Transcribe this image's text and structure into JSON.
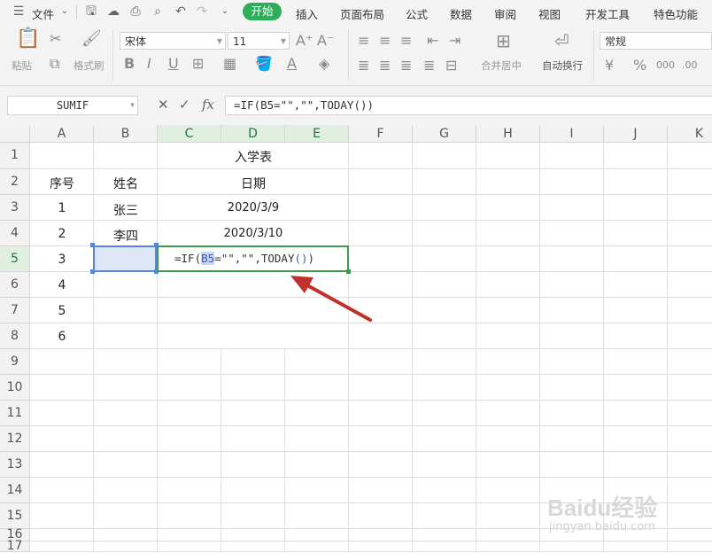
{
  "menubar": {
    "file_label": "文件",
    "tabs": [
      "开始",
      "插入",
      "页面布局",
      "公式",
      "数据",
      "审阅",
      "视图",
      "开发工具",
      "特色功能"
    ]
  },
  "ribbon": {
    "paste_label": "粘贴",
    "format_painter_label": "格式刷",
    "font_name": "宋体",
    "font_size": "11",
    "merge_center_label": "合并居中",
    "wrap_text_label": "自动换行",
    "number_format": "常规"
  },
  "formula_bar": {
    "name_box": "SUMIF",
    "formula": "=IF(B5=\"\",\"\",TODAY())"
  },
  "grid": {
    "columns": [
      "A",
      "B",
      "C",
      "D",
      "E",
      "F",
      "G",
      "H",
      "I",
      "J",
      "K"
    ],
    "rows": [
      "1",
      "2",
      "3",
      "4",
      "5",
      "6",
      "7",
      "8",
      "9",
      "10",
      "11",
      "12",
      "13",
      "14",
      "15",
      "16",
      "17"
    ],
    "title": "入学表",
    "header": [
      "序号",
      "姓名",
      "日期"
    ],
    "data": [
      {
        "no": "1",
        "name": "张三",
        "date": "2020/3/9"
      },
      {
        "no": "2",
        "name": "李四",
        "date": "2020/3/10"
      },
      {
        "no": "3",
        "name": "",
        "date": ""
      },
      {
        "no": "4",
        "name": "",
        "date": ""
      },
      {
        "no": "5",
        "name": "",
        "date": ""
      },
      {
        "no": "6",
        "name": "",
        "date": ""
      }
    ],
    "edit_cell_formula": {
      "prefix": "=IF(",
      "ref": "B5",
      "suffix": "=\"\",\"\",TODAY",
      "paren_open": "(",
      "paren_close": ")",
      "close": ")"
    }
  },
  "watermark": {
    "logo": "Baidu经验",
    "url": "jingyan.baidu.com"
  }
}
